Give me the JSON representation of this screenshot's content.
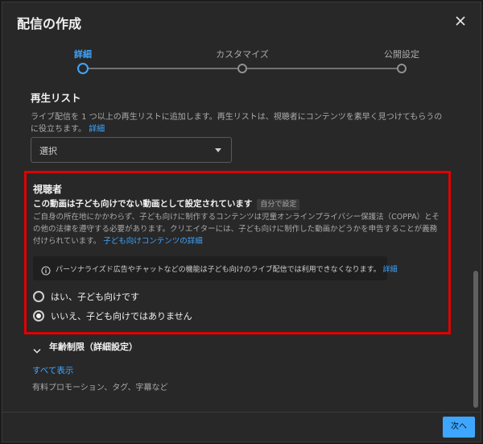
{
  "dialog": {
    "title": "配信の作成"
  },
  "stepper": {
    "steps": [
      {
        "label": "詳細"
      },
      {
        "label": "カスタマイズ"
      },
      {
        "label": "公開設定"
      }
    ]
  },
  "playlist": {
    "title": "再生リスト",
    "description": "ライブ配信を 1 つ以上の再生リストに追加します。再生リストは、視聴者にコンテンツを素早く見つけてもらうのに役立ちます。",
    "link": "詳細",
    "select_value": "選択"
  },
  "audience": {
    "title": "視聴者",
    "status": "この動画は子ども向けでない動画として設定されています",
    "badge": "自分で設定",
    "description": "ご自身の所在地にかかわらず、子ども向けに制作するコンテンツは児童オンラインプライバシー保護法（COPPA）とその他の法律を遵守する必要があります。クリエイターには、子ども向けに制作した動画かどうかを申告することが義務付けられています。",
    "description_link": "子ども向けコンテンツの詳細",
    "info": "パーソナライズド広告やチャットなどの機能は子ども向けのライブ配信では利用できなくなります。",
    "info_link": "詳細",
    "option_yes": "はい、子ども向けです",
    "option_no": "いいえ、子ども向けではありません"
  },
  "age_restriction": {
    "label": "年齢制限（詳細設定）"
  },
  "show_all": "すべて表示",
  "footnote": "有料プロモーション、タグ、字幕など",
  "next_button": "次へ"
}
